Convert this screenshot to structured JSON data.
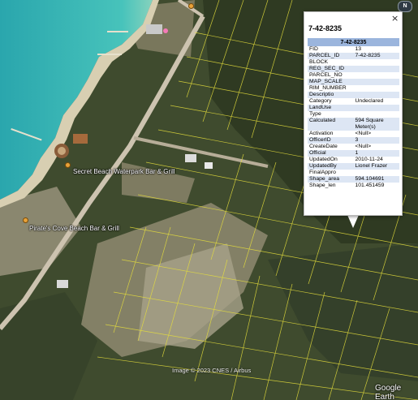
{
  "map": {
    "pois": [
      {
        "label": "Secret Beach Waterpark Bar & Grill"
      },
      {
        "label": "Pirate's Cove Beach Bar & Grill"
      }
    ],
    "attribution": "Image © 2023 CNES / Airbus",
    "brand": "Google Earth",
    "compass": "N"
  },
  "popup": {
    "title": "7-42-8235",
    "close_symbol": "×",
    "table_header": "7-42-8235",
    "rows": [
      {
        "key": "FID",
        "value": "13"
      },
      {
        "key": "PARCEL_ID",
        "value": "7-42-8235"
      },
      {
        "key": "BLOCK",
        "value": ""
      },
      {
        "key": "REG_SEC_ID",
        "value": ""
      },
      {
        "key": "PARCEL_NO",
        "value": ""
      },
      {
        "key": "MAP_SCALE",
        "value": ""
      },
      {
        "key": "RIM_NUMBER",
        "value": ""
      },
      {
        "key": "Descriptio",
        "value": ""
      },
      {
        "key": "Category",
        "value": "Undeclared"
      },
      {
        "key": "LandUse",
        "value": ""
      },
      {
        "key": "Type",
        "value": ""
      },
      {
        "key": "Calculated",
        "value": "594 Square Meter(s)"
      },
      {
        "key": "Activation",
        "value": "<Null>"
      },
      {
        "key": "OfficerID",
        "value": "3"
      },
      {
        "key": "CreateDate",
        "value": "<Null>"
      },
      {
        "key": "Official",
        "value": "1"
      },
      {
        "key": "UpdatedOn",
        "value": "2010-11-24"
      },
      {
        "key": "UpdatedBy",
        "value": "Lionel Frazer"
      },
      {
        "key": "FinalAppro",
        "value": ""
      },
      {
        "key": "Shape_area",
        "value": "594.104691"
      },
      {
        "key": "Shape_len",
        "value": "101.451459"
      }
    ]
  },
  "colors": {
    "sea": "#36b6b4",
    "vegetation": "#3d4a2c",
    "sand": "#a9a08a",
    "road": "#c9bfae",
    "parcel_lines": "#e8e23a"
  }
}
